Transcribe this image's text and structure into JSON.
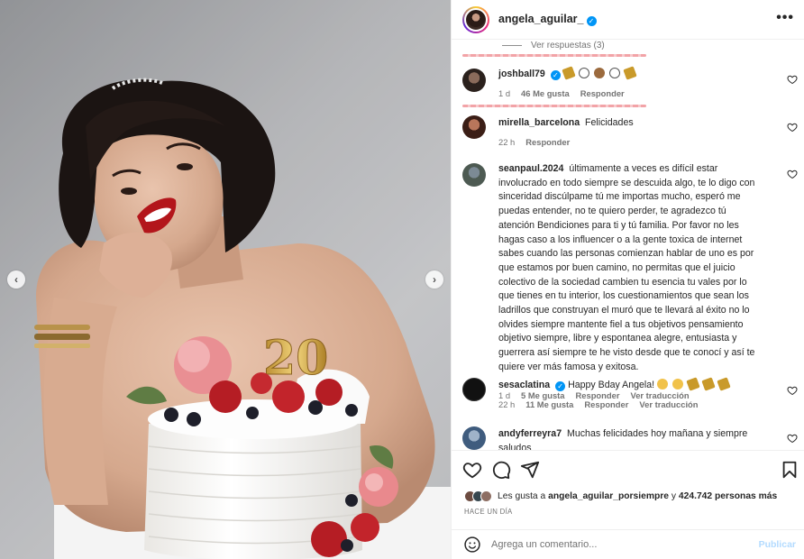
{
  "post": {
    "author": "angela_aguilar_",
    "more_label": "•••",
    "prev_arrow": "‹",
    "next_arrow": "›"
  },
  "view_replies": "Ver respuestas (3)",
  "comments": [
    {
      "user": "joshball79",
      "verified": true,
      "text": "",
      "emoji_icons": [
        "party-hat-icon",
        "white-heart-icon",
        "cake-icon",
        "white-heart-icon",
        "party-hat-icon"
      ],
      "time": "1 d",
      "likes": "46 Me gusta",
      "reply": "Responder",
      "translate": ""
    },
    {
      "user": "mirella_barcelona",
      "verified": false,
      "text": "Felicidades",
      "time": "22 h",
      "likes": "",
      "reply": "Responder",
      "translate": ""
    },
    {
      "user": "seanpaul.2024",
      "verified": false,
      "text": "últimamente a veces es difícil estar involucrado en todo siempre se descuida algo, te lo digo con sinceridad discúlpame tú me importas mucho, esperó me puedas entender, no te quiero perder, te agradezco tú atención Bendiciones para ti y tú familia. Por favor no les hagas caso a los influencer o a la gente toxica de internet sabes cuando las personas comienzan hablar de uno es por que estamos por buen camino, no permitas que el juicio colectivo de la sociedad cambien tu esencia tu vales por lo que tienes en tu interior, los cuestionamientos que sean los ladrillos que construyan el muró que te llevará al éxito no lo olvides siempre mantente fiel a tus objetivos pensamiento objetivo siempre, libre y espontanea alegre, entusiasta y guerrera así siempre te he visto desde que te conocí y así te quiere ver más famosa y exitosa.",
      "time": "1 d",
      "likes": "5 Me gusta",
      "reply": "Responder",
      "translate": "Ver traducción"
    },
    {
      "user": "sesaclatina",
      "verified": true,
      "text": "Happy Bday Angela!",
      "emoji_icons": [
        "clapping-hands-icon",
        "clapping-hands-icon",
        "party-hat-icon",
        "party-hat-icon",
        "party-hat-icon"
      ],
      "time": "22 h",
      "likes": "11 Me gusta",
      "reply": "Responder",
      "translate": "Ver traducción"
    },
    {
      "user": "andyferreyra7",
      "verified": false,
      "text": "Muchas felicidades hoy mañana y siempre saludos",
      "time": "",
      "likes": "",
      "reply": "",
      "translate": ""
    }
  ],
  "likes_summary": {
    "prefix": "Les gusta a ",
    "user": "angela_aguilar_porsiempre",
    "middle": " y ",
    "others": "424.742 personas más"
  },
  "posted_ago": "HACE UN DÍA",
  "add_comment": {
    "placeholder": "Agrega un comentario...",
    "publish": "Publicar"
  },
  "photo": {
    "cake_number": "20"
  },
  "colors": {
    "verified": "#0095f6",
    "muted": "#737373",
    "text": "#262626",
    "publish_disabled": "#b3dbff",
    "highlight_underline": "#f2a3a7"
  }
}
